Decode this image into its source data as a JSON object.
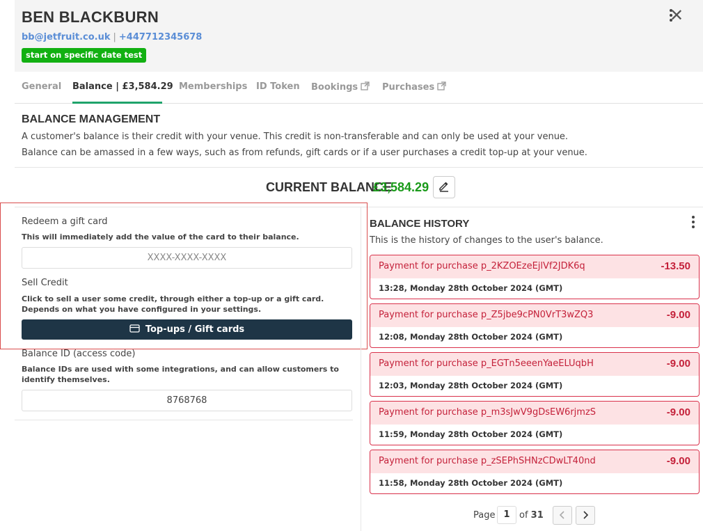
{
  "header": {
    "name": "BEN BLACKBURN",
    "email": "bb@jetfruit.co.uk",
    "separator": "|",
    "phone": "+447712345678",
    "badge": "start on specific date test"
  },
  "tabs": [
    {
      "label": "General"
    },
    {
      "label": "Balance | £3,584.29"
    },
    {
      "label": "Memberships"
    },
    {
      "label": "ID Token"
    },
    {
      "label": "Bookings"
    },
    {
      "label": "Purchases"
    }
  ],
  "balance_management": {
    "title": "BALANCE MANAGEMENT",
    "line1": "A customer's balance is their credit with your venue. This credit is non-transferable and can only be used at your venue.",
    "line2": "Balance can be amassed in a few ways, such as from refunds, gift cards or if a user purchases a credit top-up at your venue."
  },
  "current_balance": {
    "label": "CURRENT BALANCE",
    "value": "£3,584.29"
  },
  "redeem": {
    "label": "Redeem a gift card",
    "help": "This will immediately add the value of the card to their balance.",
    "placeholder": "XXXX-XXXX-XXXX"
  },
  "sell_credit": {
    "label": "Sell Credit",
    "help": "Click to sell a user some credit, through either a top-up or a gift card. Depends on what you have configured in your settings.",
    "button": "Top-ups / Gift cards"
  },
  "balance_id": {
    "label": "Balance ID (access code)",
    "help": "Balance IDs are used with some integrations, and can allow customers to identify themselves.",
    "value": "8768768"
  },
  "history": {
    "title": "BALANCE HISTORY",
    "desc": "This is the history of changes to the user's balance.",
    "items": [
      {
        "desc": "Payment for purchase p_2KZOEzeEjlVf2JDK6q",
        "amount": "-13.50",
        "time": "13:28, Monday 28th October 2024 (GMT)"
      },
      {
        "desc": "Payment for purchase p_Z5jbe9cPN0VrT3wZQ3",
        "amount": "-9.00",
        "time": "12:08, Monday 28th October 2024 (GMT)"
      },
      {
        "desc": "Payment for purchase p_EGTn5eeenYaeELUqbH",
        "amount": "-9.00",
        "time": "12:03, Monday 28th October 2024 (GMT)"
      },
      {
        "desc": "Payment for purchase p_m3sJwV9gDsEW6rjmzS",
        "amount": "-9.00",
        "time": "11:59, Monday 28th October 2024 (GMT)"
      },
      {
        "desc": "Payment for purchase p_zSEPhSHNzCDwLT40nd",
        "amount": "-9.00",
        "time": "11:58, Monday 28th October 2024 (GMT)"
      }
    ]
  },
  "pagination": {
    "page_label": "Page",
    "current": "1",
    "of_label": "of",
    "total": "31"
  },
  "icons": {
    "more": "kebab-menu-icon",
    "close": "close-icon",
    "external": "external-link-icon",
    "edit": "pencil-icon",
    "card": "credit-card-icon",
    "prev": "chevron-left-icon",
    "next": "chevron-right-icon"
  },
  "colors": {
    "badge": "#12b012",
    "link": "#5b8ed6",
    "tab_accent": "#1fa36b",
    "balance_green": "#1a9a1a",
    "negative_red": "#c4213a",
    "dark_button": "#1e3546"
  }
}
